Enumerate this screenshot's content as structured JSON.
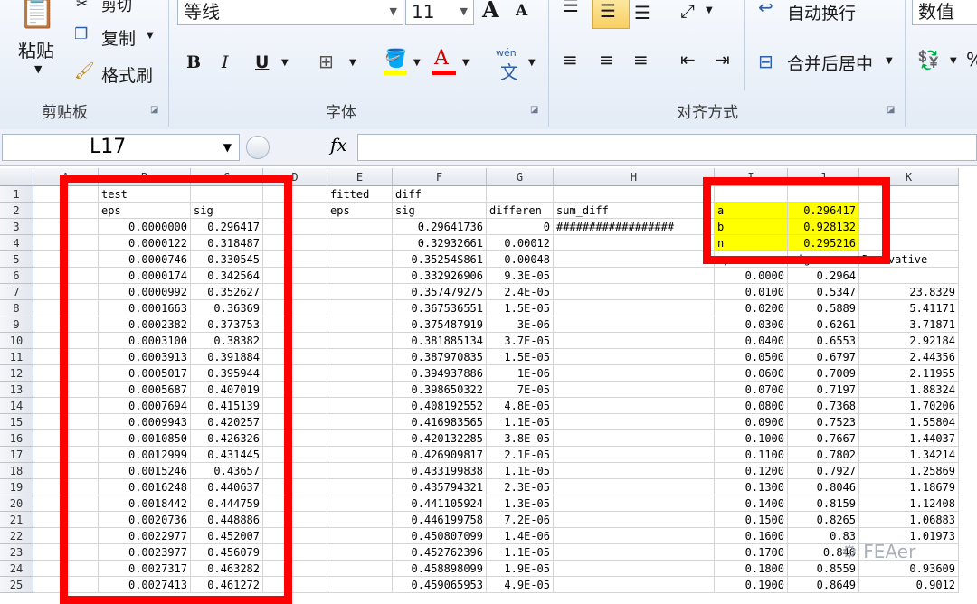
{
  "ribbon": {
    "clipboard": {
      "paste": "粘贴",
      "cut": "剪切",
      "copy": "复制",
      "format_painter": "格式刷",
      "group_label": "剪贴板"
    },
    "font": {
      "name": "等线",
      "size": "11",
      "group_label": "字体",
      "bold": "B",
      "italic": "I",
      "underline": "U",
      "grow": "A",
      "shrink": "A",
      "wen": "wén"
    },
    "alignment": {
      "wrap_text": "自动换行",
      "merge_center": "合并后居中",
      "group_label": "对齐方式"
    },
    "number": {
      "format": "数值"
    }
  },
  "formula_bar": {
    "name_box": "L17",
    "fx": "fx",
    "formula": ""
  },
  "columns": [
    "A",
    "B",
    "C",
    "D",
    "E",
    "F",
    "G",
    "H",
    "I",
    "J",
    "K"
  ],
  "rows": [
    {
      "n": "1",
      "A": "",
      "B": "test",
      "C": "",
      "D": "",
      "E": "fitted",
      "F": "diff",
      "G": "",
      "H": "",
      "I": "",
      "J": "",
      "K": ""
    },
    {
      "n": "2",
      "A": "",
      "B": "eps",
      "C": "sig",
      "D": "",
      "E": "eps",
      "F": "sig",
      "G": "differen",
      "H": "sum_diff",
      "I": "a",
      "J": "0.296417",
      "K": ""
    },
    {
      "n": "3",
      "A": "",
      "B": "0.0000000",
      "C": "0.296417",
      "D": "",
      "E": "",
      "F": "0.29641736",
      "G": "0",
      "H": "##################",
      "I": "b",
      "J": "0.928132",
      "K": ""
    },
    {
      "n": "4",
      "A": "",
      "B": "0.0000122",
      "C": "0.318487",
      "D": "",
      "E": "",
      "F": "0.32932661",
      "G": "0.00012",
      "H": "",
      "I": "n",
      "J": "0.295216",
      "K": ""
    },
    {
      "n": "5",
      "A": "",
      "B": "0.0000746",
      "C": "0.330545",
      "D": "",
      "E": "",
      "F": "0.35254S861",
      "G": "0.00048",
      "H": "",
      "I": "eps",
      "J": "sig",
      "K": "Derivative"
    },
    {
      "n": "6",
      "A": "",
      "B": "0.0000174",
      "C": "0.342564",
      "D": "",
      "E": "",
      "F": "0.332926906",
      "G": "9.3E-05",
      "H": "",
      "I": "0.0000",
      "J": "0.2964",
      "K": ""
    },
    {
      "n": "7",
      "A": "",
      "B": "0.0000992",
      "C": "0.352627",
      "D": "",
      "E": "",
      "F": "0.357479275",
      "G": "2.4E-05",
      "H": "",
      "I": "0.0100",
      "J": "0.5347",
      "K": "23.8329"
    },
    {
      "n": "8",
      "A": "",
      "B": "0.0001663",
      "C": "0.36369",
      "D": "",
      "E": "",
      "F": "0.367536551",
      "G": "1.5E-05",
      "H": "",
      "I": "0.0200",
      "J": "0.5889",
      "K": "5.41171"
    },
    {
      "n": "9",
      "A": "",
      "B": "0.0002382",
      "C": "0.373753",
      "D": "",
      "E": "",
      "F": "0.375487919",
      "G": "3E-06",
      "H": "",
      "I": "0.0300",
      "J": "0.6261",
      "K": "3.71871"
    },
    {
      "n": "10",
      "A": "",
      "B": "0.0003100",
      "C": "0.38382",
      "D": "",
      "E": "",
      "F": "0.381885134",
      "G": "3.7E-05",
      "H": "",
      "I": "0.0400",
      "J": "0.6553",
      "K": "2.92184"
    },
    {
      "n": "11",
      "A": "",
      "B": "0.0003913",
      "C": "0.391884",
      "D": "",
      "E": "",
      "F": "0.387970835",
      "G": "1.5E-05",
      "H": "",
      "I": "0.0500",
      "J": "0.6797",
      "K": "2.44356"
    },
    {
      "n": "12",
      "A": "",
      "B": "0.0005017",
      "C": "0.395944",
      "D": "",
      "E": "",
      "F": "0.394937886",
      "G": "1E-06",
      "H": "",
      "I": "0.0600",
      "J": "0.7009",
      "K": "2.11955"
    },
    {
      "n": "13",
      "A": "",
      "B": "0.0005687",
      "C": "0.407019",
      "D": "",
      "E": "",
      "F": "0.398650322",
      "G": "7E-05",
      "H": "",
      "I": "0.0700",
      "J": "0.7197",
      "K": "1.88324"
    },
    {
      "n": "14",
      "A": "",
      "B": "0.0007694",
      "C": "0.415139",
      "D": "",
      "E": "",
      "F": "0.408192552",
      "G": "4.8E-05",
      "H": "",
      "I": "0.0800",
      "J": "0.7368",
      "K": "1.70206"
    },
    {
      "n": "15",
      "A": "",
      "B": "0.0009943",
      "C": "0.420257",
      "D": "",
      "E": "",
      "F": "0.416983565",
      "G": "1.1E-05",
      "H": "",
      "I": "0.0900",
      "J": "0.7523",
      "K": "1.55804"
    },
    {
      "n": "16",
      "A": "",
      "B": "0.0010850",
      "C": "0.426326",
      "D": "",
      "E": "",
      "F": "0.420132285",
      "G": "3.8E-05",
      "H": "",
      "I": "0.1000",
      "J": "0.7667",
      "K": "1.44037"
    },
    {
      "n": "17",
      "A": "",
      "B": "0.0012999",
      "C": "0.431445",
      "D": "",
      "E": "",
      "F": "0.426909817",
      "G": "2.1E-05",
      "H": "",
      "I": "0.1100",
      "J": "0.7802",
      "K": "1.34214"
    },
    {
      "n": "18",
      "A": "",
      "B": "0.0015246",
      "C": "0.43657",
      "D": "",
      "E": "",
      "F": "0.433199838",
      "G": "1.1E-05",
      "H": "",
      "I": "0.1200",
      "J": "0.7927",
      "K": "1.25869"
    },
    {
      "n": "19",
      "A": "",
      "B": "0.0016248",
      "C": "0.440637",
      "D": "",
      "E": "",
      "F": "0.435794321",
      "G": "2.3E-05",
      "H": "",
      "I": "0.1300",
      "J": "0.8046",
      "K": "1.18679"
    },
    {
      "n": "20",
      "A": "",
      "B": "0.0018442",
      "C": "0.444759",
      "D": "",
      "E": "",
      "F": "0.441105924",
      "G": "1.3E-05",
      "H": "",
      "I": "0.1400",
      "J": "0.8159",
      "K": "1.12408"
    },
    {
      "n": "21",
      "A": "",
      "B": "0.0020736",
      "C": "0.448886",
      "D": "",
      "E": "",
      "F": "0.446199758",
      "G": "7.2E-06",
      "H": "",
      "I": "0.1500",
      "J": "0.8265",
      "K": "1.06883"
    },
    {
      "n": "22",
      "A": "",
      "B": "0.0022977",
      "C": "0.452007",
      "D": "",
      "E": "",
      "F": "0.450807099",
      "G": "1.4E-06",
      "H": "",
      "I": "0.1600",
      "J": "0.83",
      "K": "1.01973"
    },
    {
      "n": "23",
      "A": "",
      "B": "0.0023977",
      "C": "0.456079",
      "D": "",
      "E": "",
      "F": "0.452762396",
      "G": "1.1E-05",
      "H": "",
      "I": "0.1700",
      "J": "0.846",
      "K": ""
    },
    {
      "n": "24",
      "A": "",
      "B": "0.0027317",
      "C": "0.463282",
      "D": "",
      "E": "",
      "F": "0.458898099",
      "G": "1.9E-05",
      "H": "",
      "I": "0.1800",
      "J": "0.8559",
      "K": "0.93609"
    },
    {
      "n": "25",
      "A": "",
      "B": "0.0027413",
      "C": "0.461272",
      "D": "",
      "E": "",
      "F": "0.459065953",
      "G": "4.9E-05",
      "H": "",
      "I": "0.1900",
      "J": "0.8649",
      "K": "0.9012"
    }
  ],
  "highlight_color": "#ffff00",
  "annotation_color": "#ff0000",
  "watermark": "FEAer"
}
